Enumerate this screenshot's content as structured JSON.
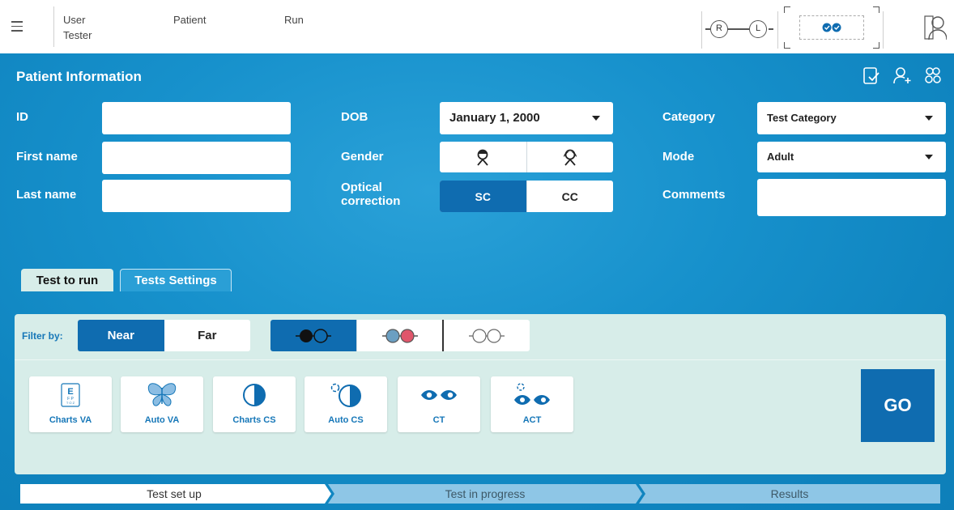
{
  "topbar": {
    "menu_icon": "hamburger-menu-icon",
    "user_label": "User",
    "user_value": "Tester",
    "patient_label": "Patient",
    "run_label": "Run",
    "eye_right": "R",
    "eye_left": "L",
    "device_icon": "vr-headset-icon",
    "profile_icon": "person-profile-icon"
  },
  "patient_info": {
    "title": "Patient Information",
    "icons": [
      "clipboard-check-icon",
      "add-person-icon",
      "group-icon"
    ],
    "fields": {
      "id_label": "ID",
      "id_value": "",
      "first_name_label": "First name",
      "first_name_value": "",
      "last_name_label": "Last name",
      "last_name_value": "",
      "dob_label": "DOB",
      "dob_value": "January 1, 2000",
      "gender_label": "Gender",
      "gender_options": [
        "male-icon",
        "female-icon"
      ],
      "optical_label_line1": "Optical",
      "optical_label_line2": "correction",
      "optical_options": [
        "SC",
        "CC"
      ],
      "optical_selected": "SC",
      "category_label": "Category",
      "category_value": "Test Category",
      "mode_label": "Mode",
      "mode_value": "Adult",
      "comments_label": "Comments",
      "comments_value": ""
    }
  },
  "tabs": {
    "test_to_run": "Test to run",
    "tests_settings": "Tests Settings",
    "active": "Test to run"
  },
  "filters": {
    "label": "Filter by:",
    "distance_options": [
      "Near",
      "Far"
    ],
    "distance_selected": "Near",
    "glasses_options": [
      "dark-glasses-icon",
      "red-blue-glasses-icon",
      "clear-glasses-icon"
    ],
    "glasses_selected": "dark-glasses-icon"
  },
  "tests": [
    {
      "label": "Charts VA",
      "icon": "eye-chart-icon"
    },
    {
      "label": "Auto VA",
      "icon": "butterfly-icon"
    },
    {
      "label": "Charts CS",
      "icon": "half-circle-icon"
    },
    {
      "label": "Auto CS",
      "icon": "auto-half-circle-icon"
    },
    {
      "label": "CT",
      "icon": "eyes-icon"
    },
    {
      "label": "ACT",
      "icon": "auto-eyes-icon"
    }
  ],
  "go_label": "GO",
  "steps": [
    {
      "label": "Test set up",
      "active": true
    },
    {
      "label": "Test in progress",
      "active": false
    },
    {
      "label": "Results",
      "active": false
    }
  ],
  "colors": {
    "primary": "#0f6cb0",
    "panel_blue": "#1791cc",
    "card_bg": "#d7ede9",
    "label_blue": "#1677b8",
    "step_inactive": "#8ec6e6"
  }
}
